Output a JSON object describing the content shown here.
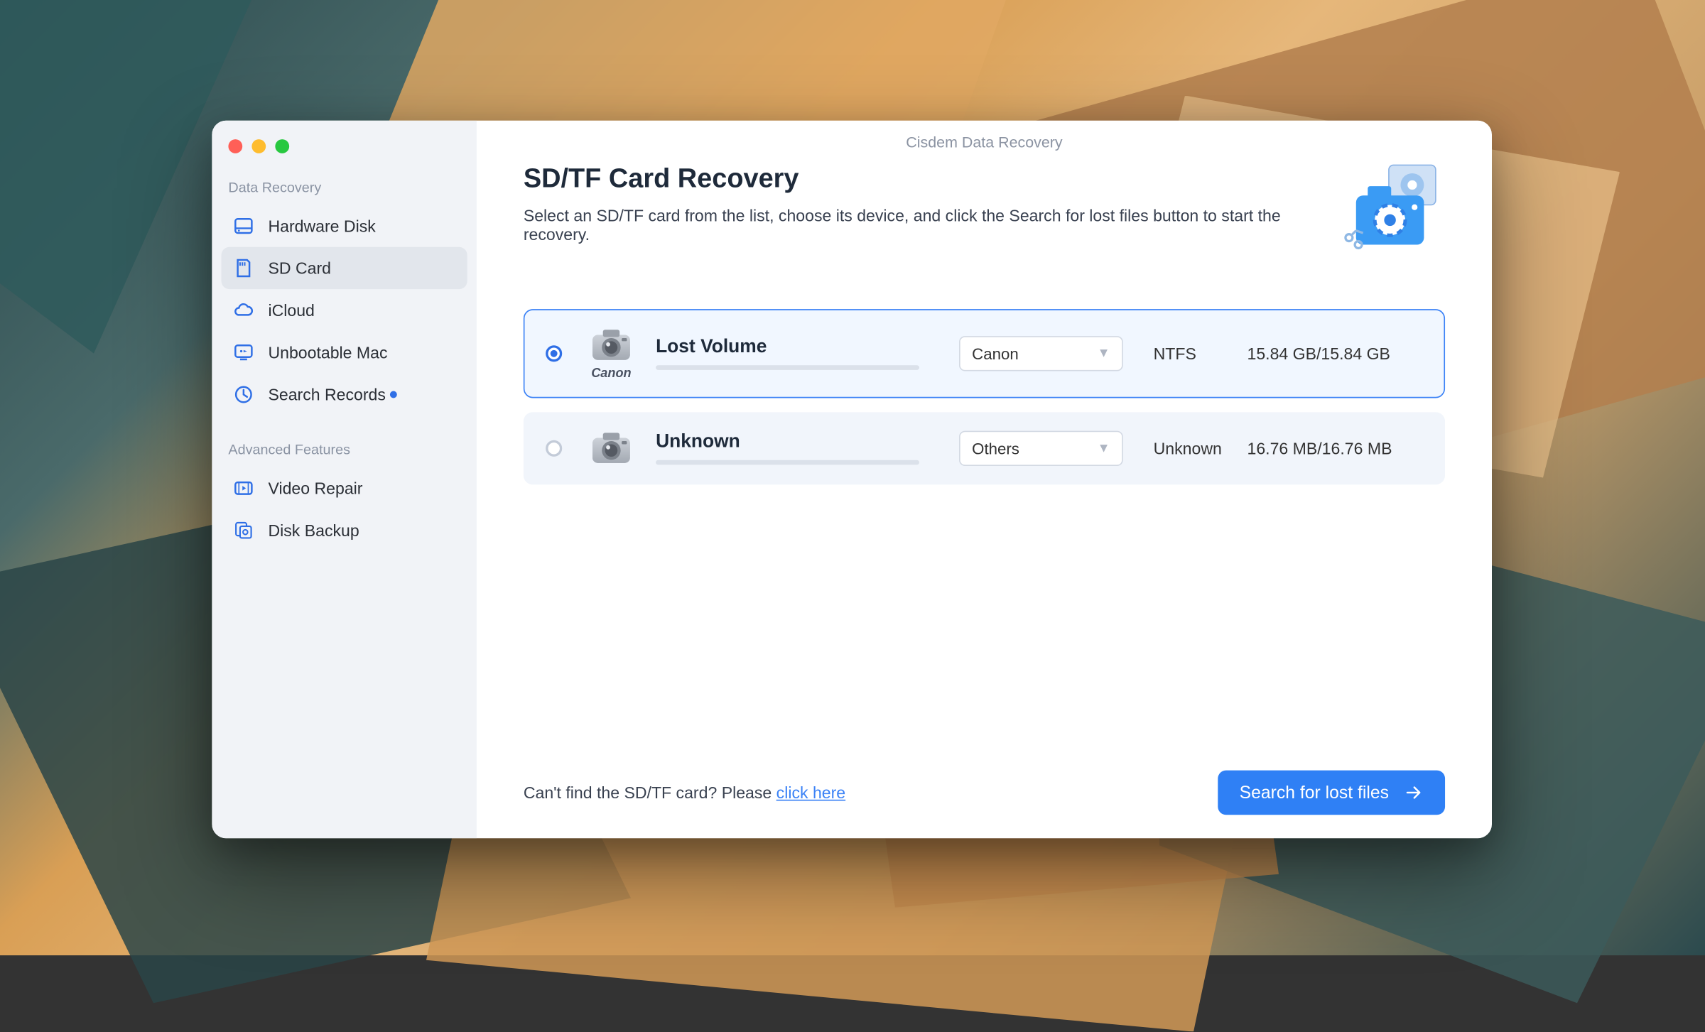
{
  "titlebar": "Cisdem Data Recovery",
  "sidebar": {
    "sections": [
      {
        "label": "Data Recovery",
        "items": [
          {
            "label": "Hardware Disk",
            "icon": "disk-icon"
          },
          {
            "label": "SD Card",
            "icon": "sdcard-icon",
            "active": true
          },
          {
            "label": "iCloud",
            "icon": "cloud-icon"
          },
          {
            "label": "Unbootable Mac",
            "icon": "monitor-icon"
          },
          {
            "label": "Search Records",
            "icon": "clock-icon",
            "badge": true
          }
        ]
      },
      {
        "label": "Advanced Features",
        "items": [
          {
            "label": "Video Repair",
            "icon": "video-icon"
          },
          {
            "label": "Disk Backup",
            "icon": "backup-icon"
          }
        ]
      }
    ]
  },
  "header": {
    "title": "SD/TF Card Recovery",
    "subtitle": "Select an SD/TF card from the list, choose its device, and click the Search for lost files button to start the recovery."
  },
  "volumes": [
    {
      "selected": true,
      "name": "Lost Volume",
      "icon_caption": "Canon",
      "device": "Canon",
      "filesystem": "NTFS",
      "size": "15.84 GB/15.84 GB"
    },
    {
      "selected": false,
      "name": "Unknown",
      "icon_caption": "",
      "device": "Others",
      "filesystem": "Unknown",
      "size": "16.76 MB/16.76 MB"
    }
  ],
  "footer": {
    "help_prefix": "Can't find the SD/TF card? Please ",
    "help_link": "click here",
    "cta": "Search for lost files"
  }
}
